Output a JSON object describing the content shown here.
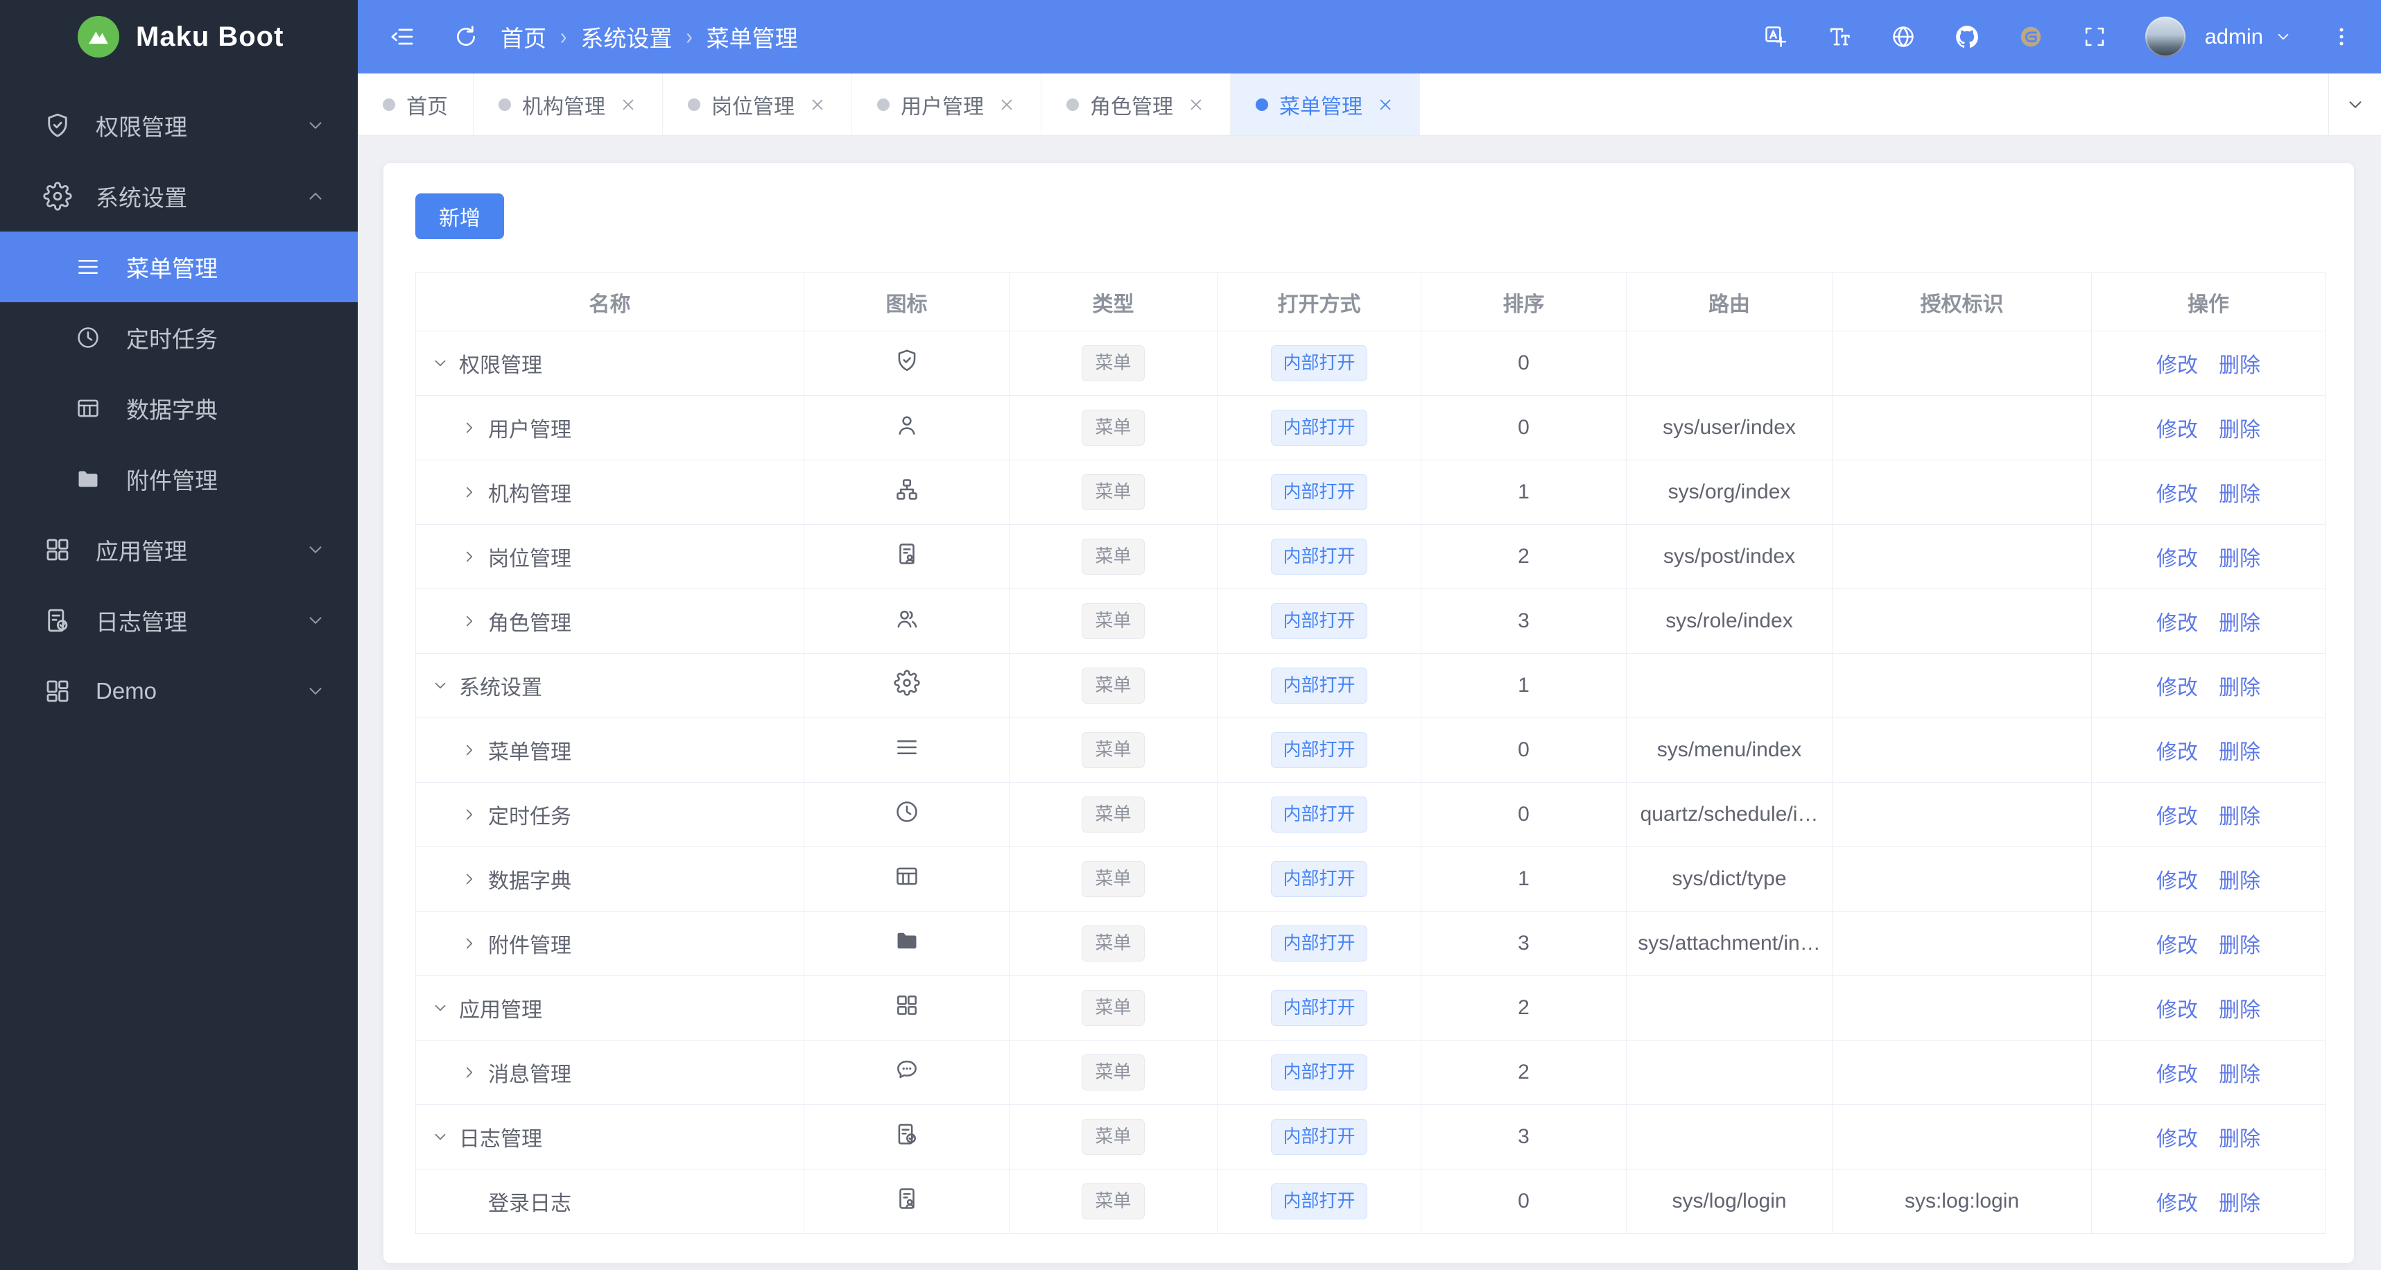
{
  "brand": {
    "name": "Maku Boot",
    "logo_icon": "mountain-icon"
  },
  "colors": {
    "topbar_blue": "#5987f0",
    "sidebar_dark": "#242c3a",
    "active_blue": "#5584ef",
    "accent_blue": "#4784f4",
    "link_blue": "#5d78e8",
    "logo_green": "#64bd50",
    "page_bg": "#eef0f4"
  },
  "topbar": {
    "left_icons": [
      {
        "icon": "menu-fold-icon"
      },
      {
        "icon": "refresh-icon"
      }
    ],
    "breadcrumb": [
      "首页",
      "系统设置",
      "菜单管理"
    ],
    "right_icons": [
      {
        "icon": "translate-icon"
      },
      {
        "icon": "font-size-icon"
      },
      {
        "icon": "globe-icon"
      },
      {
        "icon": "github-icon"
      },
      {
        "icon": "gitee-icon"
      },
      {
        "icon": "fullscreen-icon"
      }
    ],
    "user": "admin"
  },
  "sidebar": {
    "items": [
      {
        "label": "权限管理",
        "icon": "shield-check-icon",
        "chevron": "down",
        "expanded": false
      },
      {
        "label": "系统设置",
        "icon": "gear-icon",
        "chevron": "up",
        "expanded": true,
        "children": [
          {
            "label": "菜单管理",
            "icon": "menu-lines-icon",
            "active": true
          },
          {
            "label": "定时任务",
            "icon": "clock-icon",
            "active": false
          },
          {
            "label": "数据字典",
            "icon": "table-icon",
            "active": false
          },
          {
            "label": "附件管理",
            "icon": "folder-icon",
            "active": false
          }
        ]
      },
      {
        "label": "应用管理",
        "icon": "grid-icon",
        "chevron": "down",
        "expanded": false
      },
      {
        "label": "日志管理",
        "icon": "doc-check-icon",
        "chevron": "down",
        "expanded": false
      },
      {
        "label": "Demo",
        "icon": "grid2-icon",
        "chevron": "down",
        "expanded": false
      }
    ]
  },
  "tabs": {
    "items": [
      {
        "label": "首页",
        "closable": false,
        "active": false
      },
      {
        "label": "机构管理",
        "closable": true,
        "active": false
      },
      {
        "label": "岗位管理",
        "closable": true,
        "active": false
      },
      {
        "label": "用户管理",
        "closable": true,
        "active": false
      },
      {
        "label": "角色管理",
        "closable": true,
        "active": false
      },
      {
        "label": "菜单管理",
        "closable": true,
        "active": true
      }
    ]
  },
  "toolbar": {
    "add_label": "新增"
  },
  "table": {
    "headers": [
      "名称",
      "图标",
      "类型",
      "打开方式",
      "排序",
      "路由",
      "授权标识",
      "操作"
    ],
    "actions": [
      "修改",
      "删除"
    ],
    "rows": [
      {
        "name": "权限管理",
        "arrow": "down",
        "level": 0,
        "icon": "shield-check-icon",
        "type": "菜单",
        "open": "内部打开",
        "sort": "0",
        "route": "",
        "auth": ""
      },
      {
        "name": "用户管理",
        "arrow": "right",
        "level": 1,
        "icon": "user-icon",
        "type": "菜单",
        "open": "内部打开",
        "sort": "0",
        "route": "sys/user/index",
        "auth": ""
      },
      {
        "name": "机构管理",
        "arrow": "right",
        "level": 1,
        "icon": "org-tree-icon",
        "type": "菜单",
        "open": "内部打开",
        "sort": "1",
        "route": "sys/org/index",
        "auth": ""
      },
      {
        "name": "岗位管理",
        "arrow": "right",
        "level": 1,
        "icon": "id-card-icon",
        "type": "菜单",
        "open": "内部打开",
        "sort": "2",
        "route": "sys/post/index",
        "auth": ""
      },
      {
        "name": "角色管理",
        "arrow": "right",
        "level": 1,
        "icon": "users-icon",
        "type": "菜单",
        "open": "内部打开",
        "sort": "3",
        "route": "sys/role/index",
        "auth": ""
      },
      {
        "name": "系统设置",
        "arrow": "down",
        "level": 0,
        "icon": "gear-icon",
        "type": "菜单",
        "open": "内部打开",
        "sort": "1",
        "route": "",
        "auth": ""
      },
      {
        "name": "菜单管理",
        "arrow": "right",
        "level": 1,
        "icon": "menu-lines-icon",
        "type": "菜单",
        "open": "内部打开",
        "sort": "0",
        "route": "sys/menu/index",
        "auth": ""
      },
      {
        "name": "定时任务",
        "arrow": "right",
        "level": 1,
        "icon": "clock-icon",
        "type": "菜单",
        "open": "内部打开",
        "sort": "0",
        "route": "quartz/schedule/i…",
        "auth": ""
      },
      {
        "name": "数据字典",
        "arrow": "right",
        "level": 1,
        "icon": "table-icon",
        "type": "菜单",
        "open": "内部打开",
        "sort": "1",
        "route": "sys/dict/type",
        "auth": ""
      },
      {
        "name": "附件管理",
        "arrow": "right",
        "level": 1,
        "icon": "folder-icon",
        "type": "菜单",
        "open": "内部打开",
        "sort": "3",
        "route": "sys/attachment/in…",
        "auth": ""
      },
      {
        "name": "应用管理",
        "arrow": "down",
        "level": 0,
        "icon": "grid-icon",
        "type": "菜单",
        "open": "内部打开",
        "sort": "2",
        "route": "",
        "auth": ""
      },
      {
        "name": "消息管理",
        "arrow": "right",
        "level": 1,
        "icon": "chat-icon",
        "type": "菜单",
        "open": "内部打开",
        "sort": "2",
        "route": "",
        "auth": ""
      },
      {
        "name": "日志管理",
        "arrow": "down",
        "level": 0,
        "icon": "doc-check-icon",
        "type": "菜单",
        "open": "内部打开",
        "sort": "3",
        "route": "",
        "auth": ""
      },
      {
        "name": "登录日志",
        "arrow": "none",
        "level": 1,
        "icon": "id-card-icon",
        "type": "菜单",
        "open": "内部打开",
        "sort": "0",
        "route": "sys/log/login",
        "auth": "sys:log:login"
      }
    ]
  }
}
